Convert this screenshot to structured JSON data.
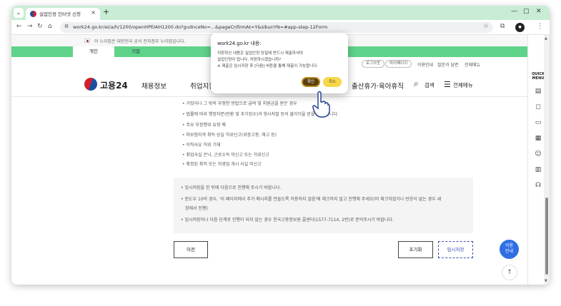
{
  "browser": {
    "tab_title": "실업인정 인터넷 신청",
    "tab_close": "×",
    "new_tab": "+",
    "url": "work24.go.kr/ei/a/h/1200/openHPEIAH1200.do?gudnceNo=...&pageCnfirmAt=Y&sibunYN=#app-step-12Form"
  },
  "gov_banner": {
    "text": "이 누리집은 대한민국 공식 전자정부 누리집입니다."
  },
  "user_tabs": {
    "personal": "개인",
    "corporate": "기업"
  },
  "utility_links": {
    "logout": "로그아웃",
    "mypage": "마이페이지",
    "guide": "이용안내",
    "faq": "질문과 답변",
    "sitemap": "전체메뉴"
  },
  "header": {
    "brand": "고용24",
    "nav": [
      "채용정보",
      "취업지원",
      "출산휴가·육아휴직"
    ],
    "search_label": "검색",
    "menu_label": "전체메뉴"
  },
  "content": {
    "list_items": [
      "거짓이나 그 밖의 부정한 방법으로 급여 및 지원금을 받은 경우",
      "법률에 따라 행정처분(반환 및 추가징수)과 형사처벌 등의 불이익을 받을 수 있습니다.",
      "주요 부정행위 유형 예",
      "피보험자격 취득·상실 허위신고(위장고용, 해고 등)",
      "이직사유 허위 기재",
      "취업사실 은닉, 근로소득 미신고 또는 허위신고",
      "확정된 취직 또는 자영업 개시 사실 미신고"
    ],
    "notice_lines": [
      "임시저장을 한 뒤에 다음으로 진행해 주시기 바랍니다.",
      "윈도우 10의 경우, '이 페이지에서 추가 메시지를 만들도록 허용하지 않음'에 체크하지 말고 진행해 주세요(미 체크하였거나 반응이 없는 경우 새",
      "창에서 진행)",
      "임시저장이나 다음 단계로 진행이 되지 않는 경우 한국고용정보원 콜센터(1577-7114, 2번)로 문의주시기 바랍니다."
    ]
  },
  "buttons": {
    "prev": "이전",
    "reset": "초기화",
    "temp_save": "임시저장"
  },
  "floating": {
    "guide_line1": "이용",
    "guide_line2": "안내",
    "top": "↑"
  },
  "quick_menu": {
    "title_line1": "QUICK",
    "title_line2": "MENU"
  },
  "dialog": {
    "title": "work24.go.kr 내용:",
    "lines": [
      "저장하신 내용은 실업인정 당일에 반드시 제출하셔야",
      "실업인정이 됩니다. 저장하시겠습니까?",
      "※ 제출은 임시저장 후 [다음] 버튼을 통해 제출이 가능합니다."
    ],
    "ok": "확인",
    "cancel": "취소"
  },
  "colors": {
    "accent_green": "#5fd38a",
    "dialog_ok": "#5a3f0c",
    "dialog_cancel": "#f7d74b",
    "link_blue": "#3a4ab5"
  }
}
